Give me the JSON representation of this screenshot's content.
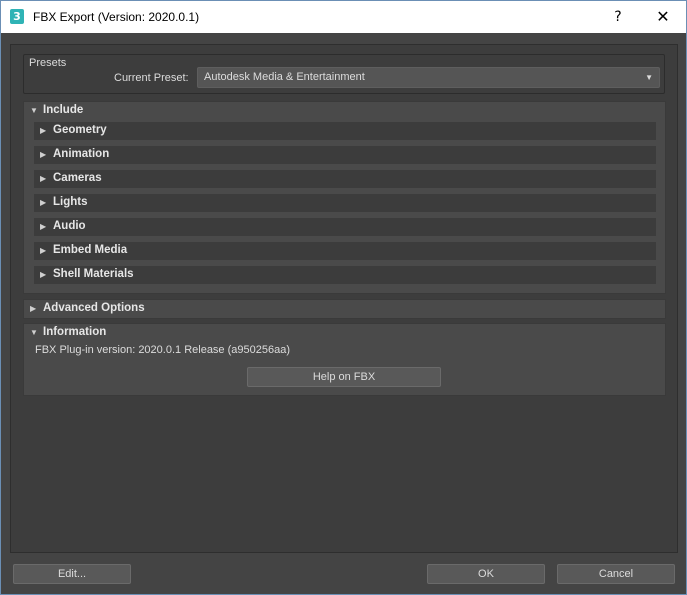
{
  "window": {
    "icon_glyph": "3",
    "title": "FBX Export (Version: 2020.0.1)",
    "help_glyph": "?",
    "close_glyph": "✕"
  },
  "presets": {
    "group_label": "Presets",
    "current_label": "Current Preset:",
    "current_value": "Autodesk Media & Entertainment",
    "dropdown_arrow": "▼"
  },
  "include": {
    "label": "Include",
    "expanded_glyph": "▼",
    "collapsed_glyph": "▶",
    "items": [
      {
        "label": "Geometry"
      },
      {
        "label": "Animation"
      },
      {
        "label": "Cameras"
      },
      {
        "label": "Lights"
      },
      {
        "label": "Audio"
      },
      {
        "label": "Embed Media"
      },
      {
        "label": "Shell Materials"
      }
    ]
  },
  "advanced": {
    "label": "Advanced Options"
  },
  "information": {
    "label": "Information",
    "plugin_version": "FBX Plug-in version: 2020.0.1 Release (a950256aa)",
    "help_button": "Help on FBX"
  },
  "footer": {
    "edit_button": "Edit...",
    "ok_button": "OK",
    "cancel_button": "Cancel"
  },
  "colors": {
    "background": "#444444",
    "panel": "#3d3d3d",
    "rollout": "#4a4a4a",
    "subrollout": "#3c3c3c",
    "button": "#595959",
    "accent_icon": "#2fb3b5"
  }
}
